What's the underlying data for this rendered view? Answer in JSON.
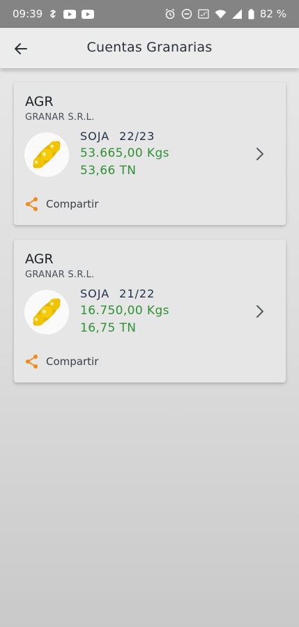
{
  "status_bar": {
    "time": "09:39",
    "battery": "82 %"
  },
  "app_bar": {
    "title": "Cuentas Granarias"
  },
  "accounts": [
    {
      "name": "AGR",
      "company": "GRANAR S.R.L.",
      "crop": "SOJA",
      "season": "22/23",
      "kgs": "53.665,00 Kgs",
      "tn": "53,66 TN",
      "share_label": "Compartir"
    },
    {
      "name": "AGR",
      "company": "GRANAR S.R.L.",
      "crop": "SOJA",
      "season": "21/22",
      "kgs": "16.750,00 Kgs",
      "tn": "16,75 TN",
      "share_label": "Compartir"
    }
  ],
  "colors": {
    "accent_share": "#f28a1c",
    "amount_green": "#2e9135",
    "soy_yellow": "#f2c400"
  },
  "icons": {
    "back": "arrow-left-icon",
    "chevron": "chevron-right-icon",
    "share": "share-icon",
    "grain": "soybean-pod-icon"
  }
}
